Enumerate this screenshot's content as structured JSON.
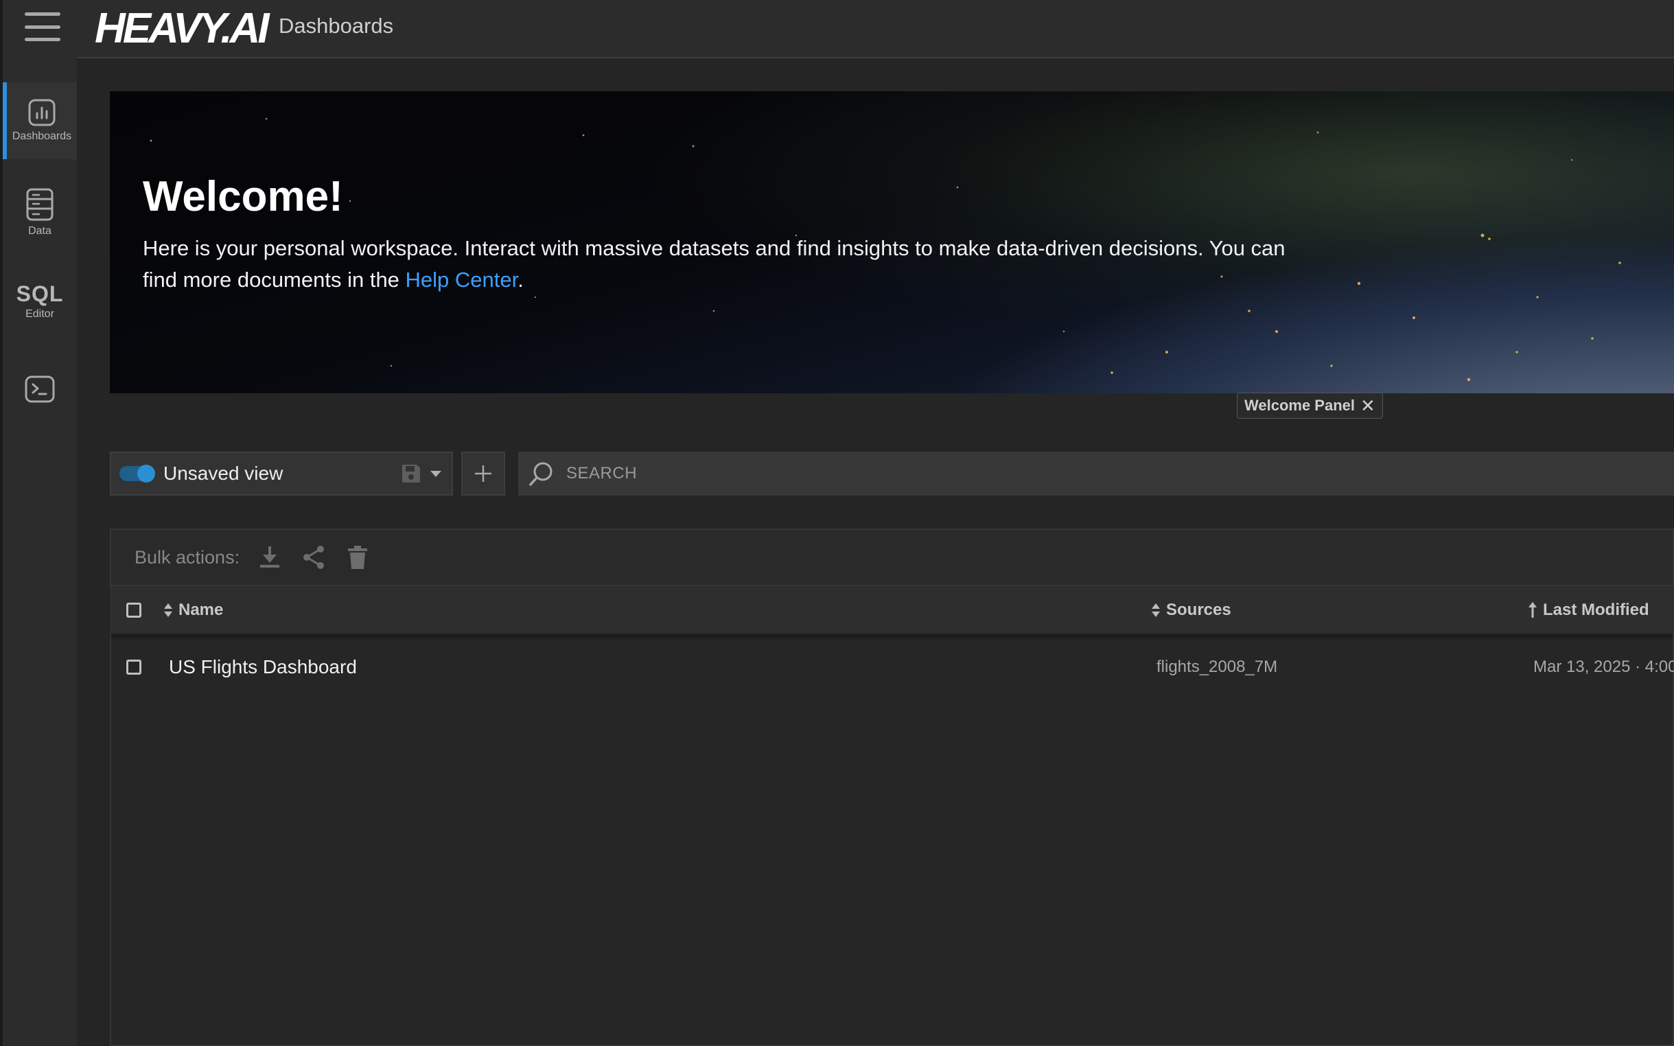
{
  "app": {
    "logo_text": "HEAVY.AI",
    "page_name": "Dashboards"
  },
  "rail": {
    "items": [
      {
        "label": "Dashboards",
        "icon": "chart-icon"
      },
      {
        "label": "Data",
        "icon": "database-icon"
      },
      {
        "label_top": "SQL",
        "label": "Editor"
      },
      {
        "icon": "terminal-icon"
      }
    ]
  },
  "banner": {
    "title": "Welcome!",
    "text_before_link": "Here is your personal workspace. Interact with massive datasets and find insights to make data-driven decisions. You can find more documents in the ",
    "link_text": "Help Center",
    "text_after_link": "."
  },
  "welcome_tag": {
    "label": "Welcome Panel",
    "close": "✕"
  },
  "toolbar": {
    "view_label": "Unsaved view",
    "add_label": "+",
    "search_placeholder": "SEARCH"
  },
  "bulk": {
    "label": "Bulk actions:"
  },
  "table": {
    "columns": [
      {
        "label": "Name",
        "sort": "both"
      },
      {
        "label": "Sources",
        "sort": "both"
      },
      {
        "label": "Last Modified",
        "sort": "asc"
      }
    ],
    "rows": [
      {
        "name": "US Flights Dashboard",
        "source": "flights_2008_7M",
        "modified": "Mar 13, 2025 · 4:00"
      }
    ]
  },
  "colors": {
    "accent": "#2e8fe0",
    "link": "#3da0ff",
    "background": "#252525"
  }
}
